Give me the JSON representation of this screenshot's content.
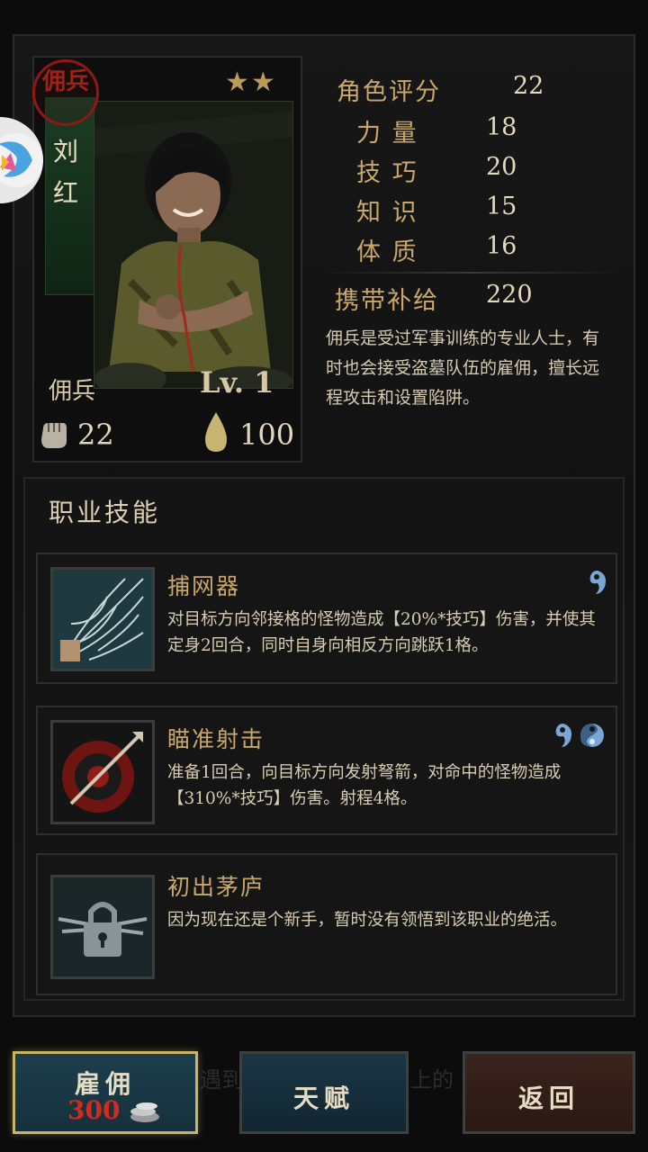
{
  "hero": {
    "seal_text": "佣兵",
    "name": "刘红",
    "name_chars": [
      "刘",
      "红"
    ],
    "stars": "★★",
    "class": "佣兵",
    "level": "Lv. 1",
    "power": "22",
    "hp": "100"
  },
  "stats": [
    {
      "label": "角色评分",
      "value": "22"
    },
    {
      "label": "力 量",
      "value": "18"
    },
    {
      "label": "技 巧",
      "value": "20"
    },
    {
      "label": "知 识",
      "value": "15"
    },
    {
      "label": "体 质",
      "value": "16"
    }
  ],
  "supply": {
    "label": "携带补给",
    "value": "220"
  },
  "description": "佣兵是受过军事训练的专业人士，有时也会接受盗墓队伍的雇佣，擅长远程攻击和设置陷阱。",
  "skills_title": "职业技能",
  "skills": [
    {
      "name": "捕网器",
      "desc": "对目标方向邻接格的怪物造成【20%*技巧】伤害，并使其定身2回合，同时自身向相反方向跳跃1格。",
      "icon": "net-icon",
      "orbs": 1
    },
    {
      "name": "瞄准射击",
      "desc": "准备1回合，向目标方向发射弩箭，对命中的怪物造成【310%*技巧】伤害。射程4格。",
      "icon": "crossbow-icon",
      "orbs": 2
    },
    {
      "name": "初出茅庐",
      "desc": "因为现在还是个新手，暂时没有领悟到该职业的绝活。",
      "icon": "locked-icon",
      "orbs": 0
    }
  ],
  "buttons": {
    "hire": "雇佣",
    "hire_cost": "300",
    "talent": "天赋",
    "back": "返回"
  },
  "background_text": {
    "left": "遇到",
    "right": "上的"
  },
  "colors": {
    "gold": "#c9a86a",
    "cost_red": "#d22a1e",
    "seal_red": "#8b1a14"
  }
}
